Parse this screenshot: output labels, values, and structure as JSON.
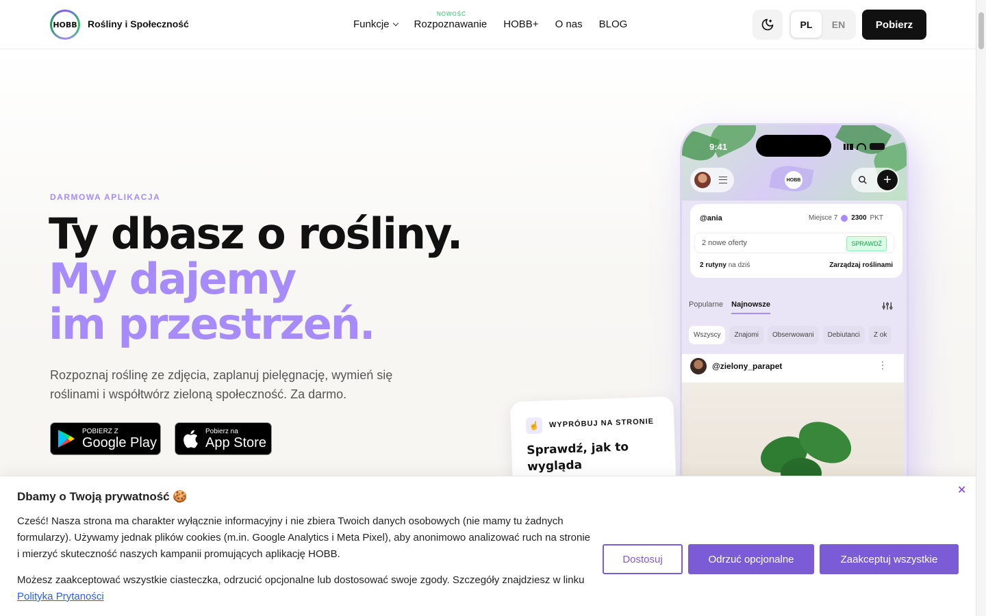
{
  "nav": {
    "brand": "Rośliny i Społeczność",
    "logo_text": "HOBB",
    "items": [
      {
        "label": "Funkcje"
      },
      {
        "label": "Rozpoznawanie"
      },
      {
        "label": "HOBB+"
      },
      {
        "label": "O nas"
      },
      {
        "label": "BLOG"
      }
    ],
    "new_badge": "NOWOŚĆ",
    "lang_pl": "PL",
    "lang_en": "EN",
    "cta": "Pobierz"
  },
  "hero": {
    "eyebrow": "DARMOWA APLIKACJA",
    "line1": "Ty dbasz o rośliny.",
    "line2": "My dajemy",
    "line3": "im przestrzeń.",
    "lead": "Rozpoznaj roślinę ze zdjęcia, zaplanuj pielęgnację, wymień się roślinami i współtwórz zieloną społeczność. Za darmo.",
    "google_small": "POBIERZ Z",
    "google_big": "Google Play",
    "apple_small": "Pobierz na",
    "apple_big": "App Store"
  },
  "phone": {
    "time": "9:41",
    "user": "@ania",
    "rank": "Miejsce 7",
    "points": "2300",
    "points_unit": "PKT",
    "offers": "2 nowe oferty",
    "check": "SPRAWDŹ",
    "routines": "2 rutyny",
    "routines_suffix": "na dziś",
    "manage": "Zarządzaj roślinami",
    "tab_popular": "Popularne",
    "tab_newest": "Najnowsze",
    "chips": [
      "Wszyscy",
      "Znajomi",
      "Obserwowani",
      "Debiutanci",
      "Z ok"
    ],
    "post_user": "@zielony_parapet"
  },
  "try_card": {
    "label": "WYPRÓBUJ NA STRONIE",
    "title": "Sprawdź, jak to wygląda"
  },
  "cookie": {
    "title": "Dbamy o Twoją prywatność 🍪",
    "p1": "Cześć! Nasza strona ma charakter wyłącznie informacyjny i nie zbiera Twoich danych osobowych (nie mamy tu żadnych formularzy). Używamy jednak plików cookies (m.in. Google Analytics i Meta Pixel), aby anonimowo analizować ruch na stronie i mierzyć skuteczność naszych kampanii promujących aplikację HOBB.",
    "p2": "Możesz zaakceptować wszystkie ciasteczka, odrzucić opcjonalne lub dostosować swoje zgody. Szczegóły znajdziesz w linku",
    "link": "Polityka Prytaności",
    "btn_customize": "Dostosuj",
    "btn_reject": "Odrzuć opcjonalne",
    "btn_accept": "Zaakceptuj wszystkie"
  },
  "colors": {
    "accent": "#a78bfa",
    "button_purple": "#7c5cd6",
    "dark": "#111111",
    "new_badge": "#22c55e"
  }
}
